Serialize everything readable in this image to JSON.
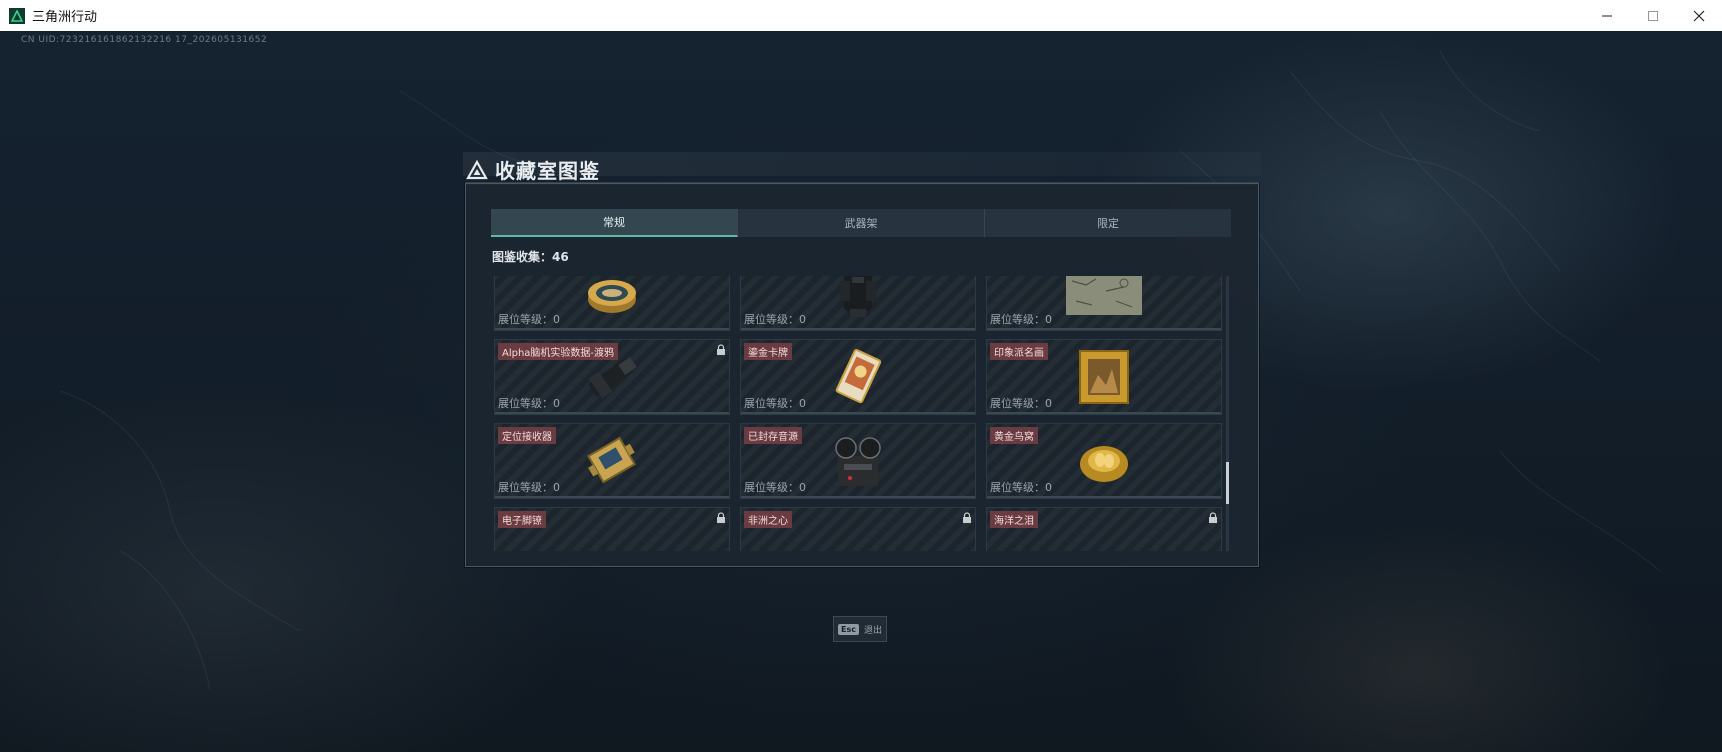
{
  "window": {
    "title": "三角洲行动"
  },
  "uid_text": "CN UID:723216161862132216 17_202605131652",
  "panel": {
    "title": "收藏室图鉴",
    "tabs": [
      {
        "label": "常规",
        "active": true
      },
      {
        "label": "武器架",
        "active": false
      },
      {
        "label": "限定",
        "active": false
      }
    ],
    "collect_label": "图鉴收集：46",
    "level_prefix": "展位等级：0"
  },
  "items": [
    {
      "name": "",
      "level": "展位等级：0",
      "icon": "caviar-tin-icon",
      "locked": false
    },
    {
      "name": "",
      "level": "展位等级：0",
      "icon": "tactical-vest-icon",
      "locked": false
    },
    {
      "name": "",
      "level": "展位等级：0",
      "icon": "old-map-icon",
      "locked": false
    },
    {
      "name": "Alpha脑机实验数据-渡鸦",
      "level": "展位等级：0",
      "icon": "tactical-device-icon",
      "locked": true
    },
    {
      "name": "鎏金卡牌",
      "level": "展位等级：0",
      "icon": "gilded-card-icon",
      "locked": false
    },
    {
      "name": "印象派名画",
      "level": "展位等级：0",
      "icon": "framed-painting-icon",
      "locked": false
    },
    {
      "name": "定位接收器",
      "level": "展位等级：0",
      "icon": "locator-receiver-icon",
      "locked": false
    },
    {
      "name": "已封存音源",
      "level": "展位等级：0",
      "icon": "reel-recorder-icon",
      "locked": false
    },
    {
      "name": "黄金鸟窝",
      "level": "展位等级：0",
      "icon": "golden-nest-icon",
      "locked": false
    },
    {
      "name": "电子脚镣",
      "level": "",
      "icon": "ankle-monitor-icon",
      "locked": true
    },
    {
      "name": "非洲之心",
      "level": "",
      "icon": "african-heart-icon",
      "locked": true
    },
    {
      "name": "海洋之泪",
      "level": "",
      "icon": "ocean-tear-icon",
      "locked": true
    }
  ],
  "footer": {
    "key": "Esc",
    "label": "退出"
  },
  "colors": {
    "accent": "#5fb7a4",
    "name_bg": "#6a3b40",
    "panel_bg": "#1c262f"
  }
}
